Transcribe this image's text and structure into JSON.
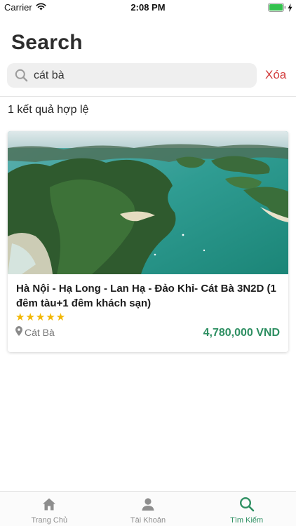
{
  "status_bar": {
    "carrier": "Carrier",
    "time": "2:08 PM"
  },
  "page": {
    "title": "Search"
  },
  "search": {
    "value": "cát bà",
    "clear_label": "Xóa"
  },
  "results": {
    "count_text": "1 kết quả hợp lệ",
    "items": [
      {
        "title": "Hà Nội - Hạ Long - Lan Hạ - Đảo Khỉ- Cát Bà 3N2D (1 đêm tàu+1 đêm khách sạn)",
        "rating": 5,
        "stars": "★★★★★",
        "location": "Cát Bà",
        "price": "4,780,000 VND"
      }
    ]
  },
  "tab_bar": {
    "tabs": [
      {
        "label": "Trang Chủ",
        "icon": "home-icon"
      },
      {
        "label": "Tài Khoản",
        "icon": "user-icon"
      },
      {
        "label": "Tìm Kiếm",
        "icon": "search-icon",
        "active": true
      }
    ]
  },
  "colors": {
    "accent": "#2e8f62",
    "danger": "#d23b3b",
    "star": "#f2b705",
    "search_bg": "#efefef"
  }
}
